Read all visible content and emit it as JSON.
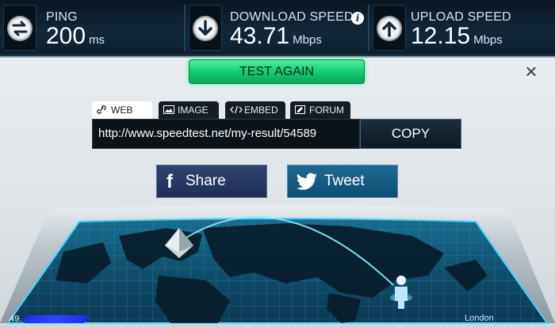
{
  "stats": {
    "ping": {
      "label": "PING",
      "value": "200",
      "unit": "ms"
    },
    "download": {
      "label": "DOWNLOAD SPEED",
      "value": "43.71",
      "unit": "Mbps"
    },
    "upload": {
      "label": "UPLOAD SPEED",
      "value": "12.15",
      "unit": "Mbps"
    }
  },
  "actions": {
    "test_again": "TEST AGAIN",
    "close": "×"
  },
  "tabs": [
    "WEB",
    "IMAGE",
    "EMBED",
    "FORUM"
  ],
  "share": {
    "url": "http://www.speedtest.net/my-result/54589",
    "copy": "COPY",
    "facebook": "Share",
    "twitter": "Tweet"
  },
  "map": {
    "server_location": "London",
    "ip_prefix": "49."
  },
  "colors": {
    "accent_green": "#12c870",
    "map_glow": "#2fc2f0",
    "bar_bg": "#11283a"
  },
  "icons": [
    "ping-icon",
    "download-icon",
    "upload-icon",
    "info-icon",
    "close-icon",
    "link-icon",
    "image-icon",
    "embed-icon",
    "forum-icon",
    "facebook-icon",
    "twitter-icon",
    "server-pyramid-icon",
    "user-pin-icon"
  ]
}
